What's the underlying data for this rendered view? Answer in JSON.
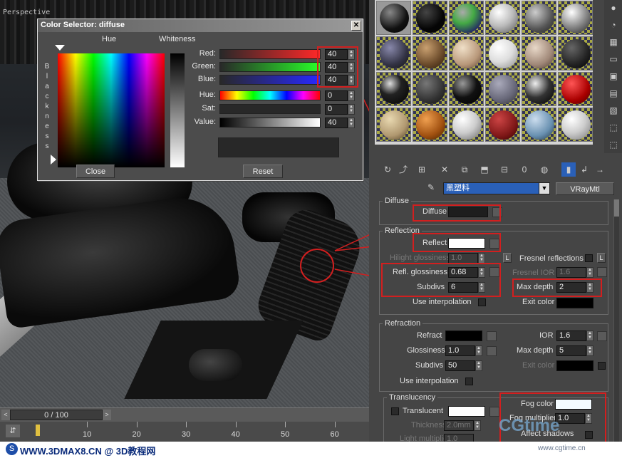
{
  "viewport": {
    "label": "Perspective"
  },
  "dialog": {
    "title": "Color Selector: diffuse",
    "close_x": "✕",
    "hue_label": "Hue",
    "whiteness_label": "Whiteness",
    "blackness_label": "Blackness",
    "channels": [
      {
        "label": "Red:",
        "value": "40"
      },
      {
        "label": "Green:",
        "value": "40"
      },
      {
        "label": "Blue:",
        "value": "40"
      },
      {
        "label": "Hue:",
        "value": "0"
      },
      {
        "label": "Sat:",
        "value": "0"
      },
      {
        "label": "Value:",
        "value": "40"
      }
    ],
    "close_button": "Close",
    "reset_button": "Reset"
  },
  "material_editor": {
    "toolbar_zero": "0",
    "material_name": "黑塑料",
    "material_type": "VRayMtl",
    "diffuse": {
      "section": "Diffuse",
      "label": "Diffuse",
      "color": "#1e1e1e"
    },
    "reflection": {
      "section": "Reflection",
      "reflect_label": "Reflect",
      "reflect_color": "#ffffff",
      "hilight_label": "Hilight glossiness",
      "hilight_value": "1.0",
      "lock": "L",
      "fresnel_label": "Fresnel reflections",
      "fresnel_ior_label": "Fresnel IOR",
      "fresnel_ior_value": "1.6",
      "refl_gloss_label": "Refl. glossiness",
      "refl_gloss_value": "0.68",
      "max_depth_label": "Max depth",
      "max_depth_value": "2",
      "subdivs_label": "Subdivs",
      "subdivs_value": "6",
      "exit_color_label": "Exit color",
      "use_interp_label": "Use interpolation"
    },
    "refraction": {
      "section": "Refraction",
      "refract_label": "Refract",
      "ior_label": "IOR",
      "ior_value": "1.6",
      "glossiness_label": "Glossiness",
      "glossiness_value": "1.0",
      "max_depth_label": "Max depth",
      "max_depth_value": "5",
      "subdivs_label": "Subdivs",
      "subdivs_value": "50",
      "exit_color_label": "Exit color",
      "use_interp_label": "Use interpolation"
    },
    "translucency": {
      "section": "Translucency",
      "translucent_label": "Translucent",
      "thickness_label": "Thickness",
      "thickness_value": "2.0mm",
      "light_mult_label": "Light multiplier",
      "light_mult_value": "1.0",
      "fog_color_label": "Fog color",
      "fog_color": "#f4fbff",
      "fog_mult_label": "Fog multiplier",
      "fog_mult_value": "1.0",
      "affect_shadows_label": "Affect shadows"
    }
  },
  "timeline": {
    "frame_display": "0 / 100",
    "prev": "<",
    "next": ">",
    "ticks": [
      "10",
      "20",
      "30",
      "40",
      "50",
      "60"
    ]
  },
  "footer": {
    "site_text": "WWW.3DMAX8.CN @ 3D教程网",
    "watermark": "CGtime",
    "watermark_url": "www.cgtime.cn"
  },
  "colors": {
    "highlight_red": "#d21f1f",
    "selected_name_bg": "#2a60b8"
  }
}
